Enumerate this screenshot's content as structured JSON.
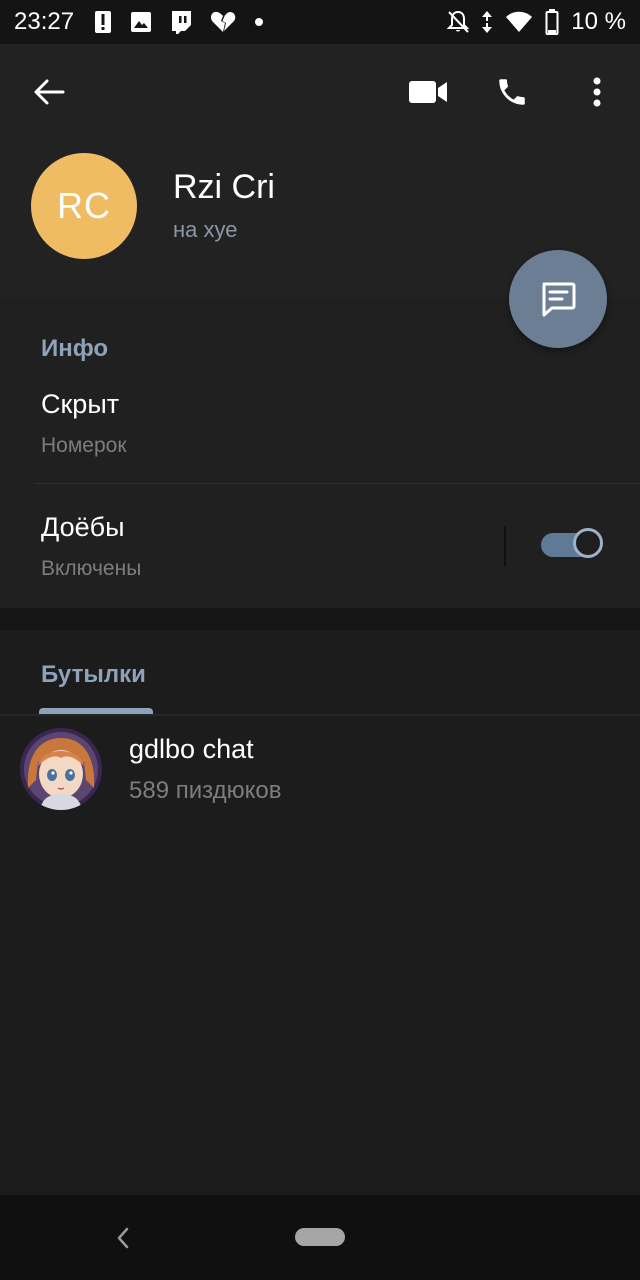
{
  "status_bar": {
    "time": "23:27",
    "battery_text": "10 %",
    "left_icons": [
      "alert-icon",
      "image-icon",
      "twitch-icon",
      "broken-heart-icon",
      "dot-icon"
    ],
    "right_icons": [
      "bell-off-icon",
      "data-arrows-icon",
      "wifi-icon",
      "battery-icon"
    ]
  },
  "toolbar": {
    "icons": [
      "back-arrow-icon",
      "video-camera-icon",
      "phone-icon",
      "more-vert-icon"
    ]
  },
  "profile": {
    "initials": "RC",
    "name": "Rzi Cri",
    "status": "на хуе",
    "avatar_color": "#f0bc63"
  },
  "fab": {
    "icon": "message-icon",
    "color": "#6b7e94"
  },
  "info": {
    "title": "Инфо",
    "phone_value": "Скрыт",
    "phone_label": "Номерок",
    "notifications_value": "Доёбы",
    "notifications_label": "Включены",
    "notifications_on": true
  },
  "groups": {
    "title": "Бутылки",
    "items": [
      {
        "name": "gdlbo chat",
        "members": "589 пиздюков"
      }
    ]
  },
  "nav": {
    "icons": [
      "nav-back-icon",
      "home-pill"
    ]
  },
  "colors": {
    "accent": "#8ea2b9",
    "header_bg": "#222222",
    "background": "#1a1a1a"
  }
}
